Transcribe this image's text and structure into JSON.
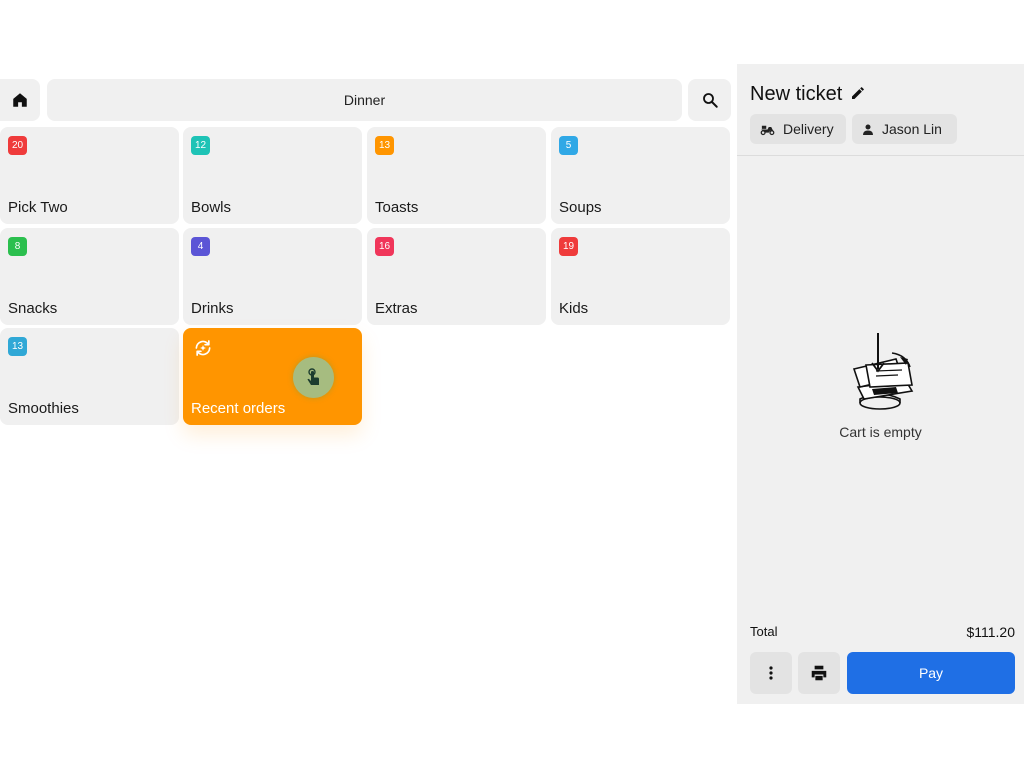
{
  "menu": {
    "category_title": "Dinner",
    "tiles": [
      {
        "label": "Pick Two",
        "count": "20",
        "color": "#ef3b3b"
      },
      {
        "label": "Bowls",
        "count": "12",
        "color": "#1ec3b6"
      },
      {
        "label": "Toasts",
        "count": "13",
        "color": "#ff9500"
      },
      {
        "label": "Soups",
        "count": "5",
        "color": "#30a8e6"
      },
      {
        "label": "Snacks",
        "count": "8",
        "color": "#2bbf4e"
      },
      {
        "label": "Drinks",
        "count": "4",
        "color": "#5b55d6"
      },
      {
        "label": "Extras",
        "count": "16",
        "color": "#f0365a"
      },
      {
        "label": "Kids",
        "count": "19",
        "color": "#ef3b3b"
      },
      {
        "label": "Smoothies",
        "count": "13",
        "color": "#30a8d6"
      }
    ],
    "recent": {
      "label": "Recent orders",
      "color": "#ff9500"
    }
  },
  "ticket": {
    "title": "New ticket",
    "order_type": "Delivery",
    "customer": "Jason Lin",
    "empty_label": "Cart is empty",
    "total_label": "Total",
    "total_amount": "$111.20",
    "pay_label": "Pay",
    "pay_color": "#1f6fe5"
  },
  "icons": [
    "home-icon",
    "search-icon",
    "edit-icon",
    "delivery-icon",
    "person-icon",
    "recent-orders-icon",
    "touch-pointer-icon",
    "more-vertical-icon",
    "print-icon",
    "empty-cart-illustration"
  ]
}
